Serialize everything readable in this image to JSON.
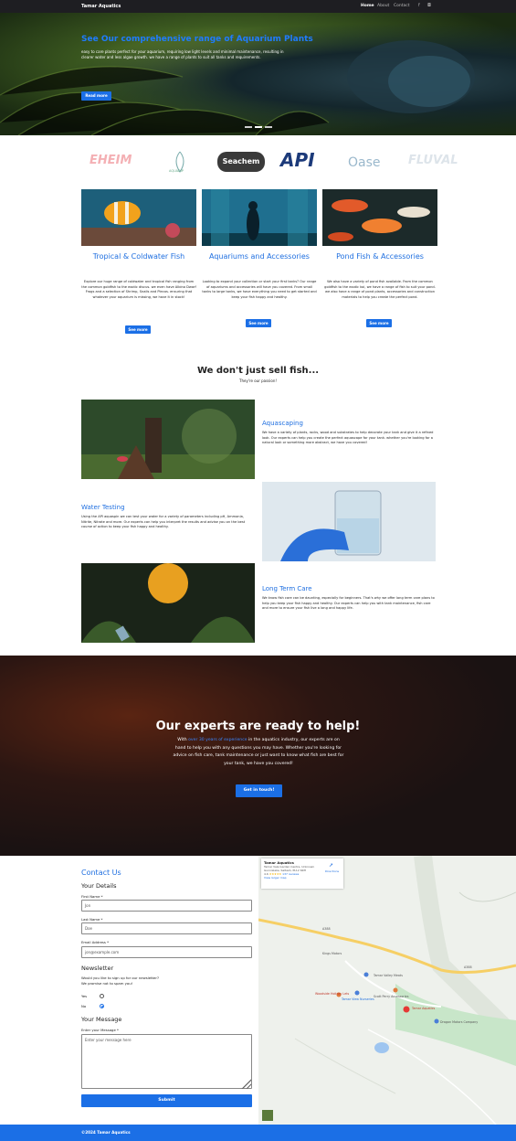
{
  "header": {
    "brand": "Tamar Aquatics",
    "nav": [
      "Home",
      "About",
      "Contact"
    ]
  },
  "hero": {
    "title": "See Our comprehensive range of Aquarium Plants",
    "text": "easy to care plants perfect for your aquarium, requiring low light levels and minimal maintenance, resulting in clearer water and less algae growth. we have a range of plants to suit all tanks and requirements.",
    "button": "Read more"
  },
  "brands": [
    "EHEIM",
    "AQUADIP",
    "Seachem",
    "API",
    "Oase",
    "FLUVAL"
  ],
  "cards": [
    {
      "title": "Tropical & Coldwater Fish",
      "text": "Explore our huge range of coldwater and tropical fish ranging from the common goldfish to the exotic discus. we even have Albino Dwarf Frogs and a selection of Shrimp, Snails and Plecos. ensuring that whatever your aquarium is missing, we have it in stock!",
      "button": "See more"
    },
    {
      "title": "Aquariums and Accessories",
      "text": "Looking to expand your collection or start your first tanks? Our range of aquariums and accessories will have you covered. From small tanks to large tanks, we have everything you need to get started and keep your fish happy and healthy.",
      "button": "See more"
    },
    {
      "title": "Pond Fish & Accessories",
      "text": "We also have a variety of pond fish available. From the common goldfish to the exotic koi, we have a range of fish to suit your pond. we also have a range of pond plants, accessories and construction materials to help you create the perfect pond.",
      "button": "See more"
    }
  ],
  "passion": {
    "title": "We don't just sell fish...",
    "subtitle": "They're our passion!"
  },
  "features": [
    {
      "title": "Aquascaping",
      "text": "We have a variety of plants, rocks, wood and substrates to help decorate your tank and give it a refined look. Our experts can help you create the perfect aquascape for your tank. whether you're looking for a natural look or something more abstract, we have you covered!"
    },
    {
      "title": "Water Testing",
      "text": "Using the API aquaspin we can test your water for a variety of parameters including pH, Ammonia, Nitrite, Nitrate and more. Our experts can help you interpret the results and advise you on the best course of action to keep your fish happy and healthy."
    },
    {
      "title": "Long Term Care",
      "text": "We know fish care can be daunting, especially for beginners. That's why we offer long term care plans to help you keep your fish happy and healthy. Our experts can help you with tank maintenance, fish care and more to ensure your fish live a long and happy life."
    }
  ],
  "experts": {
    "title": "Our experts are ready to help!",
    "text_before": "With ",
    "highlight": "over 30 years of experience",
    "text_after": " in the aquatics industry, our experts are on hand to help you with any questions you may have. Whether you're looking for advice on fish care, tank maintenance or just want to know what fish are best for your tank, we have you covered!",
    "button": "Get in touch!"
  },
  "contact": {
    "title": "Contact Us",
    "details": "Your Details",
    "first_label": "First Name *",
    "first_value": "Jon",
    "last_label": "Last Name *",
    "last_value": "Doe",
    "email_label": "Email Address *",
    "email_value": "jon@example.com",
    "newsletter": "Newsletter",
    "newsletter_q": "Would you like to sign up for our newsletter?",
    "newsletter_note": "We promise not to spam you!",
    "yes": "Yes",
    "no": "No",
    "message_title": "Your Message",
    "message_label": "Enter your Message *",
    "message_placeholder": "Enter your message here",
    "submit": "Submit"
  },
  "map": {
    "place": "Tamar Aquatics",
    "address": "Tamar Vale Garden Centre, Unknown Gunnislake, Saltash, PL12 6RH",
    "rating": "4.6",
    "reviews": "137 reviews",
    "larger": "View larger map",
    "directions": "Directions",
    "labels": [
      "Tamar Valley Meats",
      "Scott Perry Accessories",
      "Woodside Holiday Lets",
      "Tamar View Nurseries",
      "Tamar Aquatics",
      "Dragon Motors Company",
      "Kings Motors",
      "A388",
      "A388"
    ]
  },
  "footer": {
    "text": "©2024 Tamar Aquatics"
  },
  "colors": {
    "accent": "#1b6fe6",
    "dark": "#1e1e22"
  }
}
